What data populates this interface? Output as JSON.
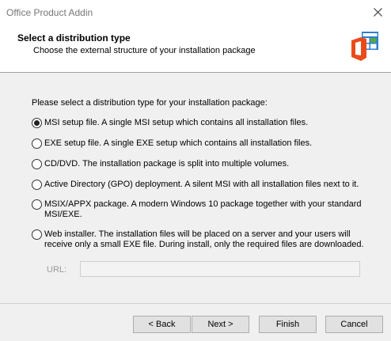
{
  "window": {
    "title": "Office Product Addin"
  },
  "header": {
    "title": "Select a distribution type",
    "subtitle": "Choose the external structure of your installation package"
  },
  "prompt": "Please select a distribution type for your installation package:",
  "options": [
    {
      "label": "MSI setup file. A single MSI setup which contains all installation files.",
      "selected": true
    },
    {
      "label": "EXE setup file. A single EXE setup which contains all installation files.",
      "selected": false
    },
    {
      "label": "CD/DVD. The installation package is split into multiple volumes.",
      "selected": false
    },
    {
      "label": "Active Directory (GPO) deployment. A silent MSI with all installation files next to it.",
      "selected": false
    },
    {
      "label": "MSIX/APPX package. A modern Windows 10 package together with your standard MSI/EXE.",
      "selected": false
    },
    {
      "label": "Web installer. The installation files will be placed on a server and your users will receive only a small EXE file. During install, only the required files are downloaded.",
      "selected": false
    }
  ],
  "url": {
    "label": "URL:",
    "value": ""
  },
  "buttons": {
    "back": "< Back",
    "next": "Next >",
    "finish": "Finish",
    "cancel": "Cancel"
  },
  "colors": {
    "logo_orange": "#e94b1b",
    "logo_blue": "#2d7fd0",
    "logo_green": "#58a846"
  },
  "icons": {
    "close": "close-icon",
    "logo": "office-logo-icon"
  }
}
